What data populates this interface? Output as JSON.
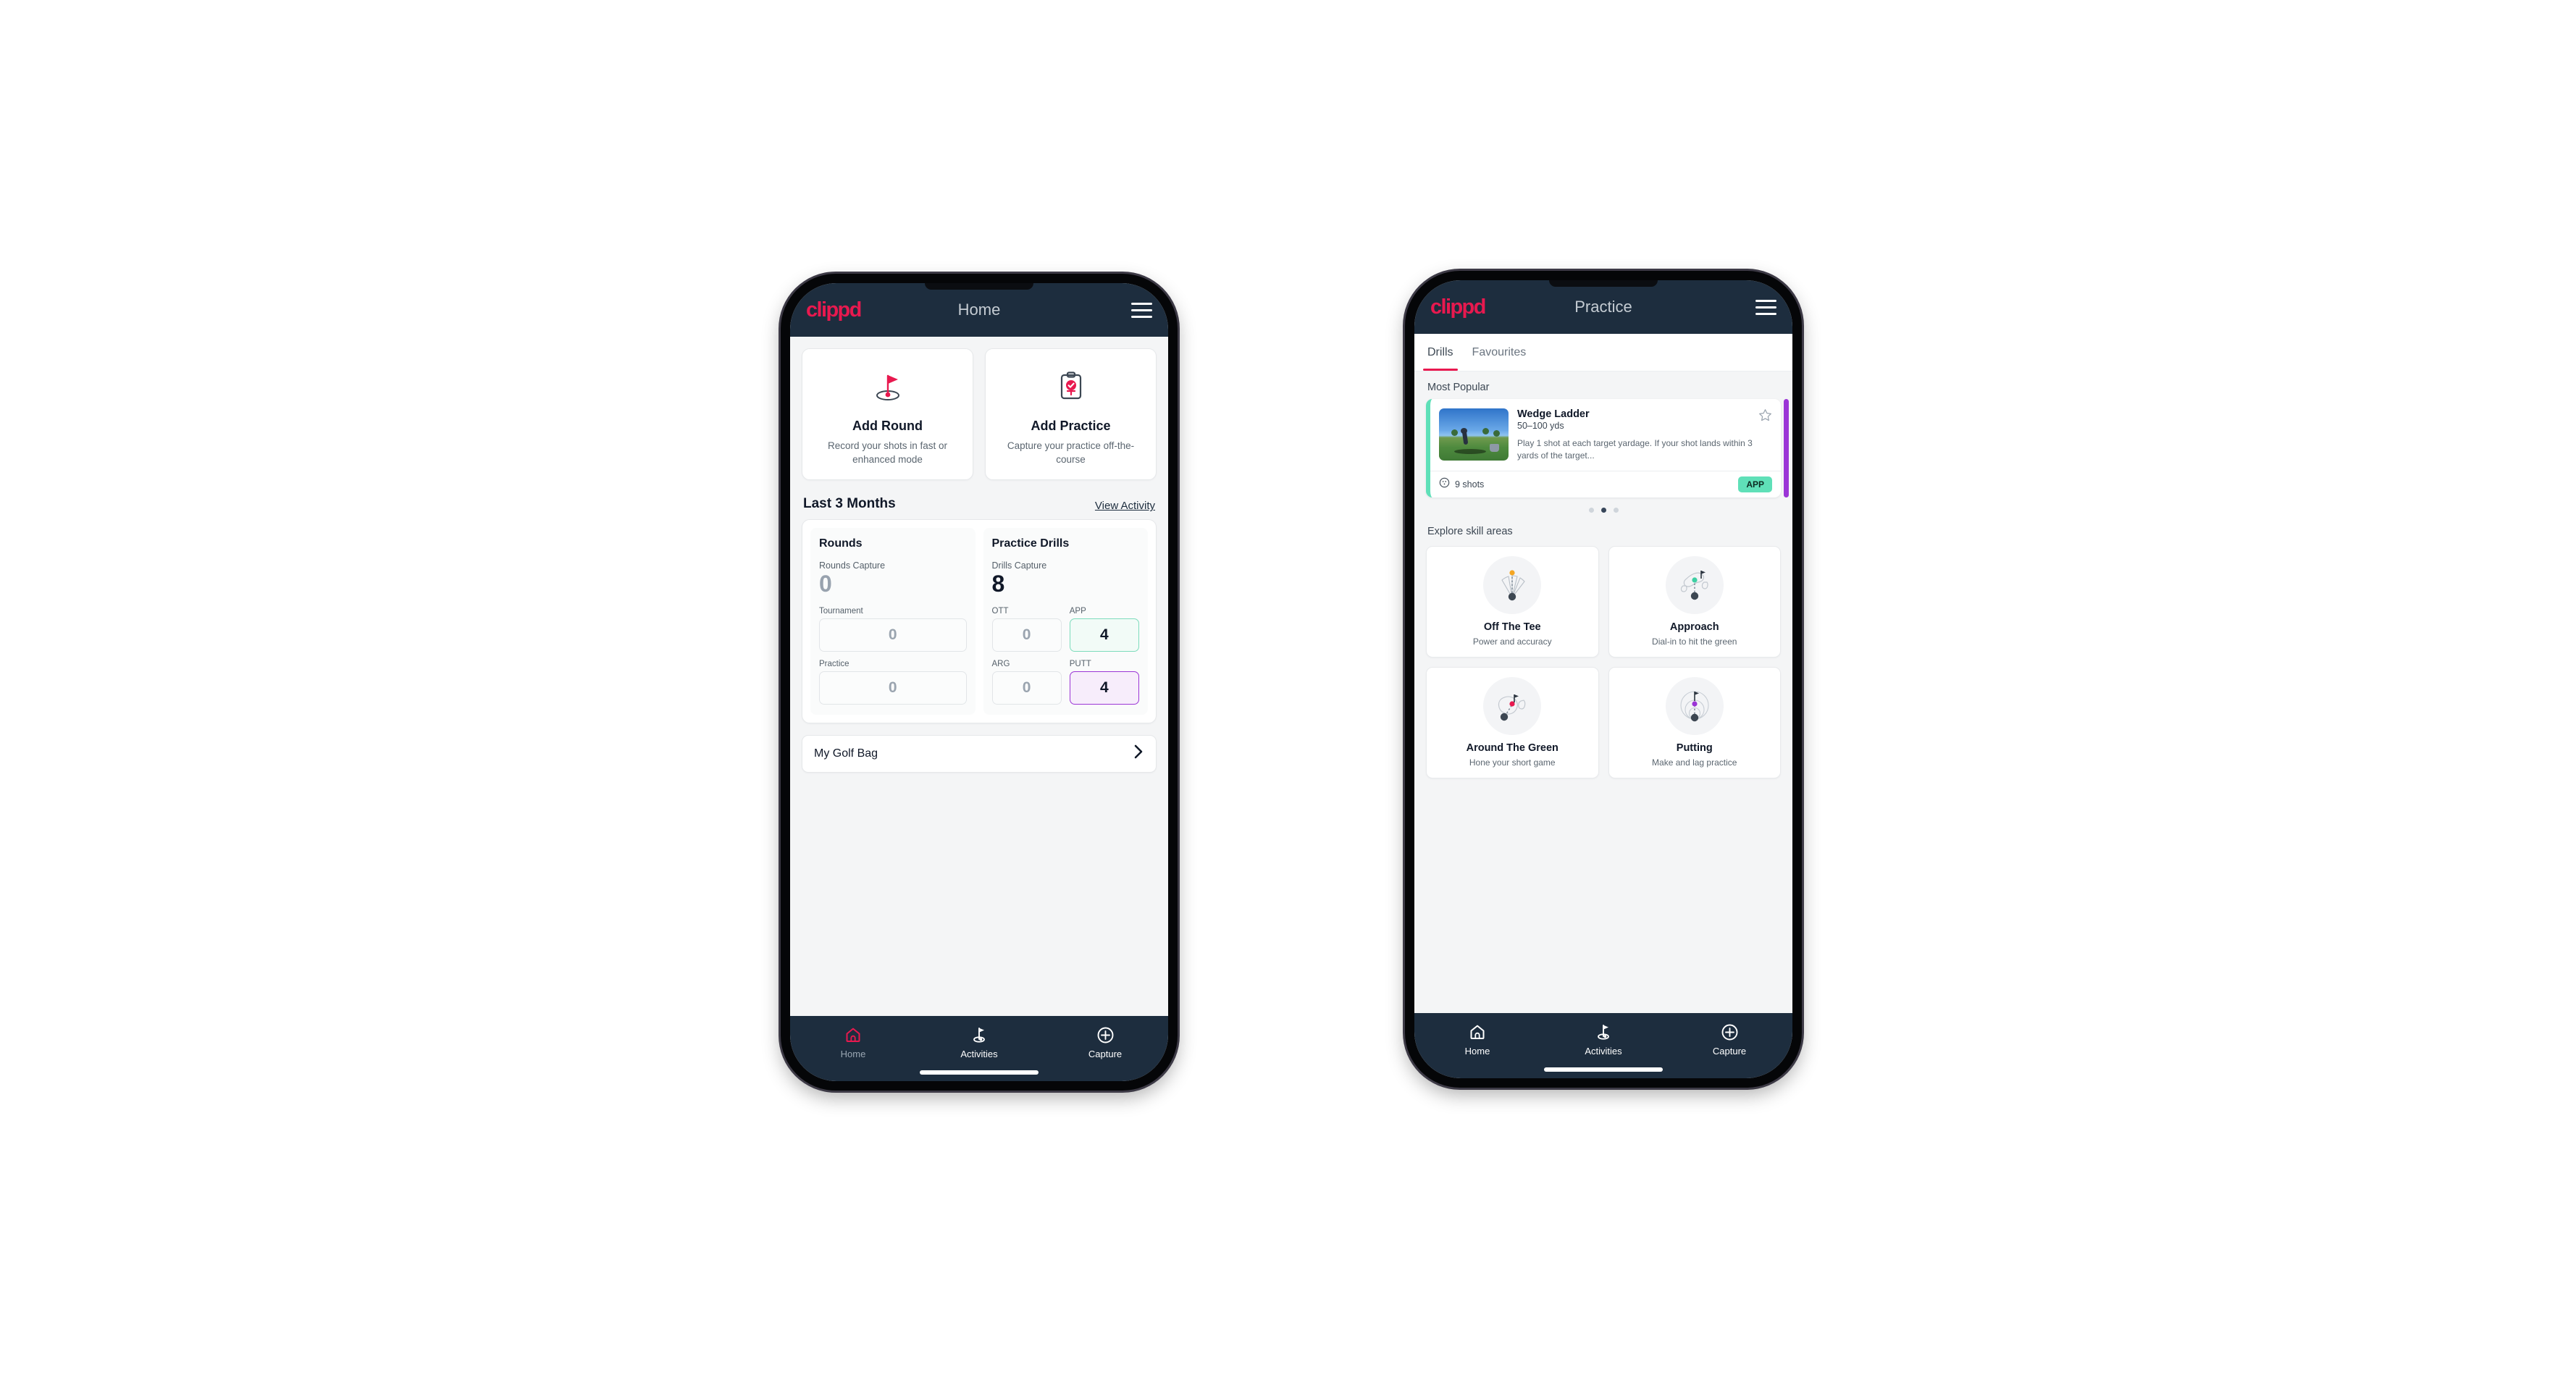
{
  "brand": {
    "name": "clippd",
    "accent": "#e8194f",
    "header_bg": "#1d2d3e"
  },
  "phone_home": {
    "appbar": {
      "title": "Home",
      "menu_label": "Menu"
    },
    "actions": [
      {
        "icon": "golf-flag-icon",
        "title": "Add Round",
        "subtitle": "Record your shots in fast or enhanced mode"
      },
      {
        "icon": "clipboard-check-icon",
        "title": "Add Practice",
        "subtitle": "Capture your practice off-the-course"
      }
    ],
    "section": {
      "title": "Last 3 Months",
      "link": "View Activity"
    },
    "rounds": {
      "heading": "Rounds",
      "capture_label": "Rounds Capture",
      "capture_value": "0",
      "fields": [
        {
          "label": "Tournament",
          "value": "0",
          "state": "empty"
        },
        {
          "label": "Practice",
          "value": "0",
          "state": "empty"
        }
      ]
    },
    "drills": {
      "heading": "Practice Drills",
      "capture_label": "Drills Capture",
      "capture_value": "8",
      "fields": [
        {
          "label": "OTT",
          "value": "0",
          "state": "empty"
        },
        {
          "label": "APP",
          "value": "4",
          "state": "teal"
        },
        {
          "label": "ARG",
          "value": "0",
          "state": "empty"
        },
        {
          "label": "PUTT",
          "value": "4",
          "state": "purple"
        }
      ]
    },
    "golf_bag": {
      "label": "My Golf Bag"
    },
    "bottom_nav": [
      {
        "icon": "home-icon",
        "label": "Home",
        "active": true
      },
      {
        "icon": "golf-flag-icon",
        "label": "Activities",
        "active": false
      },
      {
        "icon": "plus-circle-icon",
        "label": "Capture",
        "active": false
      }
    ]
  },
  "phone_practice": {
    "appbar": {
      "title": "Practice",
      "menu_label": "Menu"
    },
    "tabs": [
      {
        "label": "Drills",
        "active": true
      },
      {
        "label": "Favourites",
        "active": false
      }
    ],
    "most_popular_label": "Most Popular",
    "drill": {
      "title": "Wedge Ladder",
      "yardage": "50–100 yds",
      "description": "Play 1 shot at each target yardage. If your shot lands within 3 yards of the target...",
      "shots": "9 shots",
      "badge": "APP",
      "accent": "#5fe0b8",
      "favourite": false
    },
    "carousel_dots": {
      "count": 3,
      "active_index": 1
    },
    "explore_label": "Explore skill areas",
    "skills": [
      {
        "icon": "tee-fan-icon",
        "title": "Off The Tee",
        "subtitle": "Power and accuracy",
        "dot_color": "#f5a623"
      },
      {
        "icon": "green-target-icon",
        "title": "Approach",
        "subtitle": "Dial-in to hit the green",
        "dot_color": "#3ecfa3"
      },
      {
        "icon": "chip-green-icon",
        "title": "Around The Green",
        "subtitle": "Hone your short game",
        "dot_color": "#e8194f"
      },
      {
        "icon": "putt-rings-icon",
        "title": "Putting",
        "subtitle": "Make and lag practice",
        "dot_color": "#9b35d6"
      }
    ],
    "bottom_nav": [
      {
        "icon": "home-icon",
        "label": "Home",
        "active": false
      },
      {
        "icon": "golf-flag-icon",
        "label": "Activities",
        "active": false
      },
      {
        "icon": "plus-circle-icon",
        "label": "Capture",
        "active": false
      }
    ]
  }
}
